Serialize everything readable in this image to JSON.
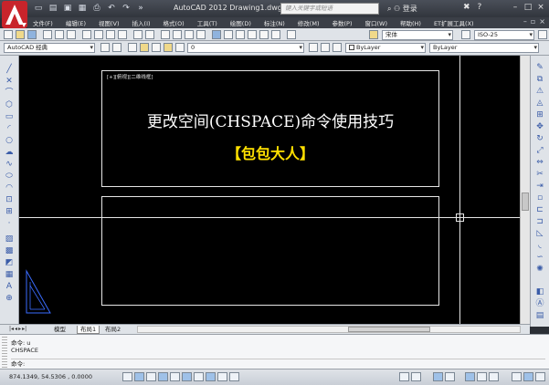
{
  "window": {
    "title": "AutoCAD 2012   Drawing1.dwg",
    "search_placeholder": "键入关键字或短语",
    "login_label": "登录",
    "minimize": "–",
    "maximize": "□",
    "close": "×"
  },
  "menu": [
    "文件(F)",
    "编辑(E)",
    "视图(V)",
    "插入(I)",
    "格式(O)",
    "工具(T)",
    "绘图(D)",
    "标注(N)",
    "修改(M)",
    "参数(P)",
    "窗口(W)",
    "帮助(H)",
    "ET扩展工具(X)"
  ],
  "toolbar": {
    "workspace": "AutoCAD 经典",
    "layer": "0",
    "text_style": "宋体",
    "dim_style": "ISO-25",
    "color": "ByLayer",
    "linetype": "ByLayer"
  },
  "canvas": {
    "viewport_label": "[+][俯视][二维线框]",
    "main_title": "更改空间(CHSPACE)命令使用技巧",
    "author": "【包包大人】",
    "colors": {
      "background": "#000000",
      "title": "#ffffff",
      "author": "#ffe000"
    }
  },
  "tabs": {
    "model": "模型",
    "layout1": "布局1",
    "layout2": "布局2"
  },
  "command": {
    "line1": "命令: u",
    "line2": "CHSPACE",
    "prompt": "命令:"
  },
  "status": {
    "coords": "874.1349,  54.5306 ,  0.0000"
  },
  "icons": {
    "logo": "autocad-a-icon",
    "ucs": "ucs-triangle-icon"
  }
}
